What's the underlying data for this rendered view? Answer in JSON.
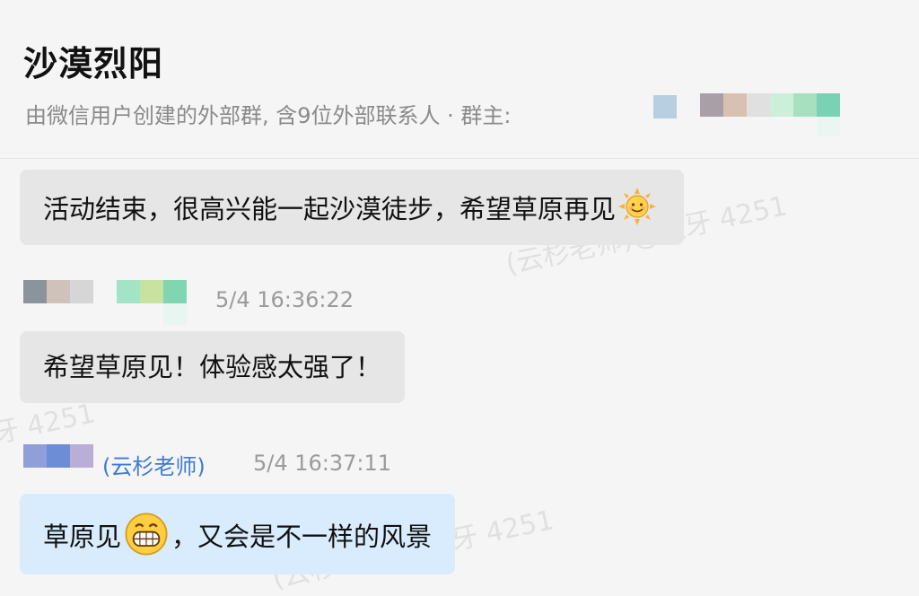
{
  "header": {
    "title": "沙漠烈阳",
    "subtitle": "由微信用户创建的外部群, 含9位外部联系人 · 群主:"
  },
  "watermark": {
    "text_a": "(云杉老师)@板牙 4251",
    "text_b": "牙 4251"
  },
  "messages": [
    {
      "text_before": "活动结束，很高兴能一起沙漠徒步，希望草原再见",
      "emoji": "sun-emoji",
      "text_after": ""
    },
    {
      "time": "5/4 16:36:22",
      "text_before": "希望草原见！体验感太强了！"
    },
    {
      "sender": "(云杉老师)",
      "time": "5/4 16:37:11",
      "text_before": "草原见",
      "emoji": "grin-emoji",
      "text_after": "，又会是不一样的风景"
    }
  ],
  "colors": {
    "background": "#f5f5f5",
    "bubble_other": "#e6e6e6",
    "bubble_self": "#d8ecfd",
    "sender_link": "#3f7bd2"
  }
}
